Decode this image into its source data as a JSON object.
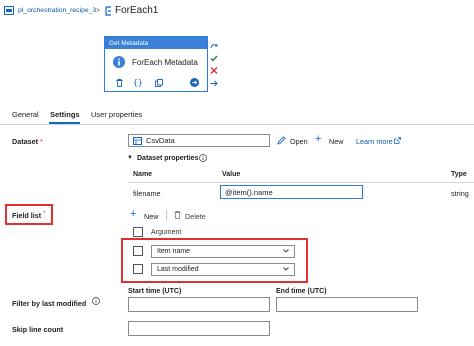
{
  "breadcrumb": {
    "pipeline": "pl_orchestration_recipe_3",
    "separator": ">",
    "current": "ForEach1"
  },
  "activity": {
    "type_label": "Get Metadata",
    "name": "ForEach Metadata"
  },
  "tabs": [
    {
      "label": "General"
    },
    {
      "label": "Settings"
    },
    {
      "label": "User properties"
    }
  ],
  "active_tab": "Settings",
  "dataset": {
    "label": "Dataset",
    "required": "*",
    "value": "CsvData",
    "open_label": "Open",
    "new_label": "New",
    "learn_more_label": "Learn more"
  },
  "dataset_properties": {
    "toggle_label": "Dataset properties",
    "columns": [
      "Name",
      "Value",
      "Type"
    ],
    "rows": [
      {
        "name": "filename",
        "value": "@item().name",
        "type": "string"
      }
    ]
  },
  "field_list": {
    "label": "Field list",
    "required": "*",
    "new_label": "New",
    "delete_label": "Delete",
    "column_header": "Argument",
    "items": [
      "Item name",
      "Last modified"
    ]
  },
  "filter_by_last_modified": {
    "label": "Filter by last modified",
    "start_label": "Start time (UTC)",
    "end_label": "End time (UTC)",
    "start_value": "",
    "end_value": ""
  },
  "skip_line_count": {
    "label": "Skip line count",
    "value": ""
  },
  "colors": {
    "accent": "#0f6cbd",
    "card_header": "#3a80d8",
    "highlight": "#e03030",
    "success": "#1e8a3c",
    "danger": "#d13438"
  }
}
